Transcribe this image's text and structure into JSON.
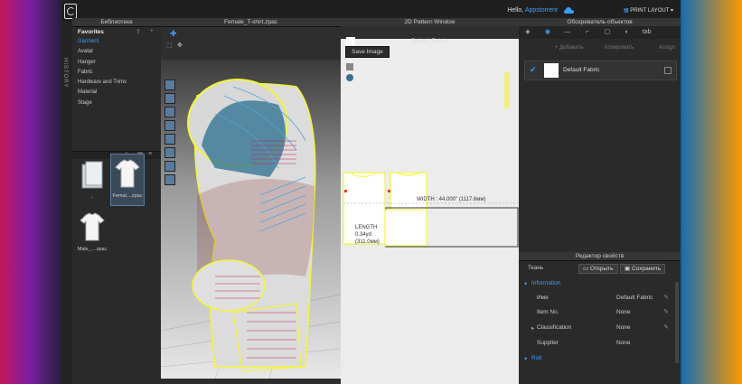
{
  "app": {
    "hello_prefix": "Hello, ",
    "username": "Appstorrent",
    "layout_label": "PRINT LAYOUT"
  },
  "history_label": "HISTORY",
  "library": {
    "title": "Библиотека",
    "favorites": "Favorites",
    "items": [
      "Garment",
      "Avatar",
      "Hanger",
      "Fabric",
      "Hardware and Trims",
      "Material",
      "Stage"
    ],
    "files": [
      {
        "label": "..",
        "kind": "folder"
      },
      {
        "label": "Femal....zpac",
        "kind": "tshirt"
      },
      {
        "label": "Male_....zpac",
        "kind": "tshirt"
      }
    ]
  },
  "view3d": {
    "title": "Female_T-shirt.zpac"
  },
  "pattern": {
    "title": "2D Pattern Window",
    "fabric": "Default Fabric",
    "save_label": "Save Image",
    "width_label": "WIDTH : 44.000\" (1117.6мм)",
    "length_label": "LENGTH",
    "length_value": "0.34yd",
    "length_mm": "(311.0мм)"
  },
  "object_browser": {
    "title": "Обозреватель объектов",
    "tabs": [
      "◈",
      "◉",
      "—",
      "⌐",
      "▢",
      "◐",
      "tab"
    ],
    "add_label": "+ Добавить",
    "copy_label": "Копировать",
    "assign_label": "Assign",
    "item_name": "Default Fabric"
  },
  "properties": {
    "title": "Редактор свойств",
    "type_label": "Ткань",
    "open_label": "Открыть",
    "save_label": "Сохранить",
    "section": "Information",
    "rows": [
      {
        "key": "Имя",
        "value": "Default Fabric"
      },
      {
        "key": "Item No.",
        "value": "None"
      },
      {
        "key": "Classification",
        "value": "None"
      },
      {
        "key": "Supplier",
        "value": "None"
      }
    ],
    "section2": "Roll"
  },
  "colors": {
    "accent": "#3ba0ff",
    "dark": "#2b2b2b",
    "highlight": "#f4f43a"
  }
}
